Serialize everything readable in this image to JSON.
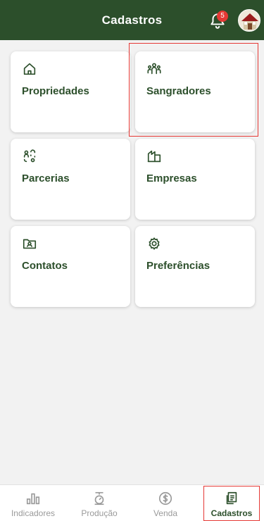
{
  "header": {
    "title": "Cadastros",
    "notification_count": "5"
  },
  "cards": [
    {
      "label": "Propriedades",
      "icon": "house-icon"
    },
    {
      "label": "Sangradores",
      "icon": "people-group-icon"
    },
    {
      "label": "Parcerias",
      "icon": "partnership-icon"
    },
    {
      "label": "Empresas",
      "icon": "building-icon"
    },
    {
      "label": "Contatos",
      "icon": "contact-card-icon"
    },
    {
      "label": "Preferências",
      "icon": "gear-icon"
    }
  ],
  "bottom_nav": {
    "items": [
      {
        "label": "Indicadores",
        "icon": "bar-chart-icon",
        "active": false
      },
      {
        "label": "Produção",
        "icon": "scale-icon",
        "active": false
      },
      {
        "label": "Venda",
        "icon": "dollar-icon",
        "active": false
      },
      {
        "label": "Cadastros",
        "icon": "documents-icon",
        "active": true
      }
    ]
  },
  "colors": {
    "header_bg": "#2c4f2b",
    "accent": "#2c4f2b",
    "badge": "#e53935",
    "highlight": "#e53935"
  }
}
